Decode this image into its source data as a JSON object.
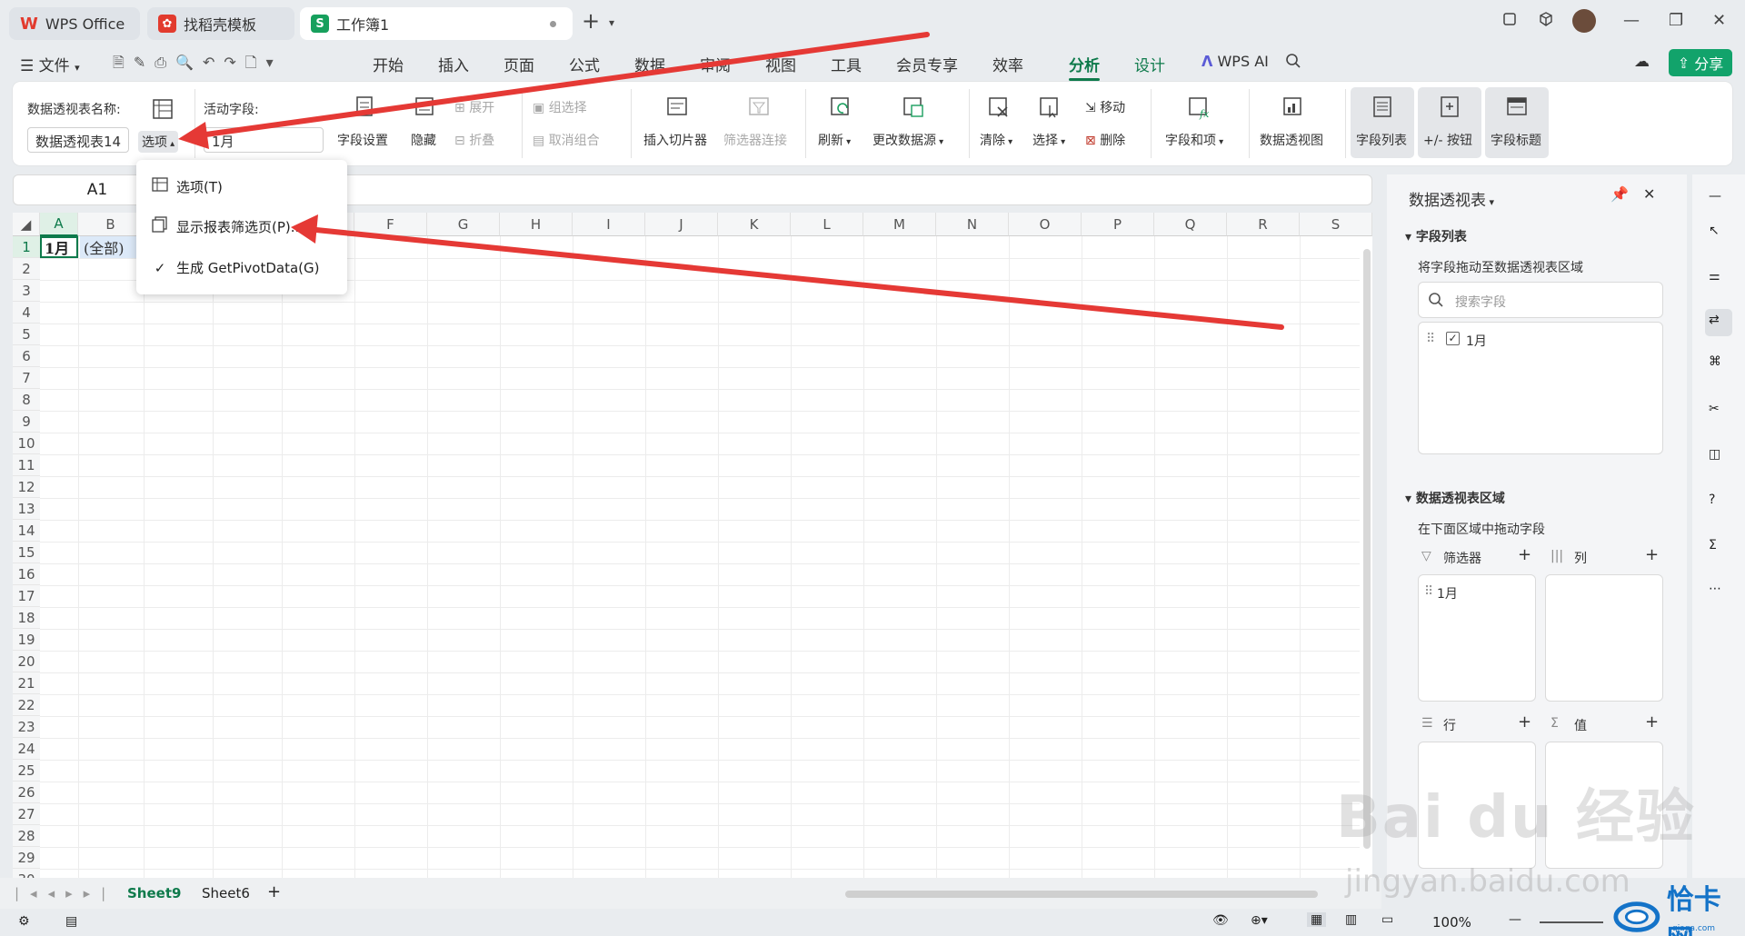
{
  "tabs": [
    {
      "label": "WPS Office"
    },
    {
      "label": "找稻壳模板"
    },
    {
      "label": "工作簿1"
    }
  ],
  "menu": {
    "file": "文件",
    "items": [
      "开始",
      "插入",
      "页面",
      "公式",
      "数据",
      "审阅",
      "视图",
      "工具",
      "会员专享",
      "效率",
      "分析",
      "设计"
    ],
    "active": "分析",
    "wps_ai": "WPS AI",
    "share": "分享"
  },
  "ribbon": {
    "pivot_name_label": "数据透视表名称:",
    "pivot_name_value": "数据透视表14",
    "options_label": "选项",
    "active_field_label": "活动字段:",
    "active_field_value": "1月",
    "field_settings": "字段设置",
    "hide": "隐藏",
    "expand": "展开",
    "collapse": "折叠",
    "group_selection": "组选择",
    "ungroup": "取消组合",
    "insert_slicer": "插入切片器",
    "filter_connections": "筛选器连接",
    "refresh": "刷新",
    "change_source": "更改数据源",
    "clear": "清除",
    "select": "选择",
    "move": "移动",
    "delete": "删除",
    "fields_items": "字段和项",
    "pivot_chart": "数据透视图",
    "field_list": "字段列表",
    "buttons": "+/- 按钮",
    "field_headers": "字段标题"
  },
  "dropdown": {
    "items": [
      {
        "label": "选项(T)"
      },
      {
        "label": "显示报表筛选页(P)..."
      },
      {
        "label": "生成 GetPivotData(G)",
        "checked": true
      }
    ]
  },
  "formula": {
    "name_box": "A1"
  },
  "grid": {
    "columns": [
      "A",
      "B",
      "C",
      "D",
      "E",
      "F",
      "G",
      "H",
      "I",
      "J",
      "K",
      "L",
      "M",
      "N",
      "O",
      "P",
      "Q",
      "R",
      "S"
    ],
    "rows": [
      "1",
      "2",
      "3",
      "4",
      "5",
      "6",
      "7",
      "8",
      "9",
      "10",
      "11",
      "12",
      "13",
      "14",
      "15",
      "16",
      "17",
      "18",
      "19",
      "20",
      "21",
      "22",
      "23",
      "24",
      "25",
      "26",
      "27",
      "28",
      "29",
      "30"
    ],
    "a1": "1月",
    "b1": "(全部)"
  },
  "sheets": {
    "tabs": [
      "Sheet9",
      "Sheet6"
    ],
    "active": "Sheet9"
  },
  "status": {
    "zoom": "100%"
  },
  "panel": {
    "title": "数据透视表",
    "field_list_header": "字段列表",
    "drag_hint": "将字段拖动至数据透视表区域",
    "search_placeholder": "搜索字段",
    "fields": [
      {
        "label": "1月",
        "checked": true
      }
    ],
    "areas_header": "数据透视表区域",
    "areas_hint": "在下面区域中拖动字段",
    "filter_label": "筛选器",
    "column_label": "列",
    "row_label": "行",
    "value_label": "值",
    "filter_items": [
      "1月"
    ]
  },
  "watermark": {
    "text": "Bai du 经验",
    "url": "jingyan.baidu.com",
    "corner_logo": "恰卡网",
    "corner_sub": "qiaqa.com"
  },
  "colors": {
    "accent": "#0e7a4b",
    "share": "#12a36b",
    "arrow": "#e53935"
  }
}
